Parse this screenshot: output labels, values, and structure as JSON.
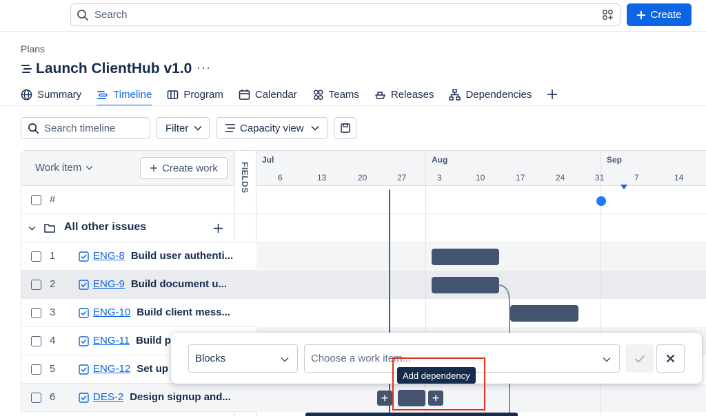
{
  "topbar": {
    "search_placeholder": "Search",
    "create_label": "Create"
  },
  "header": {
    "breadcrumb": "Plans",
    "title": "Launch ClientHub v1.0",
    "more": "···"
  },
  "tabs": [
    {
      "label": "Summary",
      "icon": "globe-icon",
      "active": false
    },
    {
      "label": "Timeline",
      "icon": "timeline-icon",
      "active": true
    },
    {
      "label": "Program",
      "icon": "board-icon",
      "active": false
    },
    {
      "label": "Calendar",
      "icon": "calendar-icon",
      "active": false
    },
    {
      "label": "Teams",
      "icon": "people-icon",
      "active": false
    },
    {
      "label": "Releases",
      "icon": "ship-icon",
      "active": false
    },
    {
      "label": "Dependencies",
      "icon": "hierarchy-icon",
      "active": false
    }
  ],
  "toolbar": {
    "search_placeholder": "Search timeline",
    "filter_label": "Filter",
    "capacity_label": "Capacity view"
  },
  "list": {
    "header_label": "Work item",
    "create_label": "Create work",
    "fields_label": "FIELDS",
    "hash_label": "#",
    "group_label": "All other issues",
    "rows": [
      {
        "num": "1",
        "key": "ENG-8",
        "summary": "Build user authenti..."
      },
      {
        "num": "2",
        "key": "ENG-9",
        "summary": "Build document u..."
      },
      {
        "num": "3",
        "key": "ENG-10",
        "summary": "Build client mess..."
      },
      {
        "num": "4",
        "key": "ENG-11",
        "summary": "Build pro"
      },
      {
        "num": "5",
        "key": "ENG-12",
        "summary": "Set up p"
      },
      {
        "num": "6",
        "key": "DES-2",
        "summary": "Design signup and..."
      }
    ]
  },
  "timeline": {
    "months": [
      "Jul",
      "Aug",
      "Sep"
    ],
    "days": [
      "6",
      "13",
      "20",
      "27",
      "3",
      "10",
      "17",
      "24",
      "31",
      "7",
      "14"
    ]
  },
  "popup": {
    "type_value": "Blocks",
    "item_placeholder": "Choose a work item..."
  },
  "tooltip": "Add dependency",
  "colors": {
    "accent": "#0c66e4",
    "bar": "#44546f",
    "highlight": "#e2331f"
  }
}
